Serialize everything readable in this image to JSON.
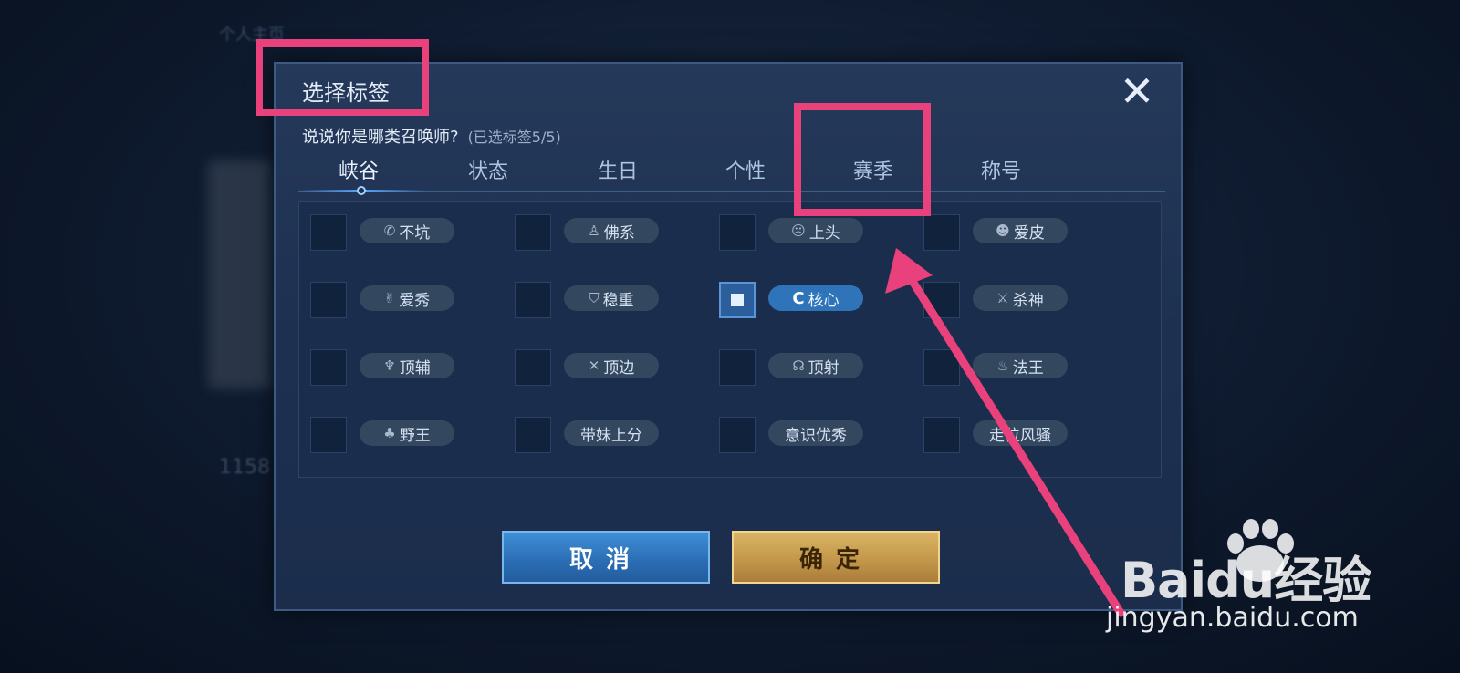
{
  "background": {
    "blurred_labels": [
      "个人主页",
      "1158"
    ]
  },
  "dialog": {
    "title": "选择标签",
    "close_icon": "close-icon",
    "subtitle": "说说你是哪类召唤师?",
    "selected_count": "(已选标签5/5)",
    "tabs": [
      {
        "label": "峡谷",
        "active": true
      },
      {
        "label": "状态",
        "active": false
      },
      {
        "label": "生日",
        "active": false
      },
      {
        "label": "个性",
        "active": false
      },
      {
        "label": "赛季",
        "active": false
      },
      {
        "label": "称号",
        "active": false
      }
    ],
    "tag_rows": [
      [
        {
          "label": "不坑",
          "icon": "phone-icon",
          "checked": false
        },
        {
          "label": "佛系",
          "icon": "buddha-icon",
          "checked": false
        },
        {
          "label": "上头",
          "icon": "face-icon",
          "checked": false
        },
        {
          "label": "爱皮",
          "icon": "cat-icon",
          "checked": false
        }
      ],
      [
        {
          "label": "爱秀",
          "icon": "peace-hand-icon",
          "checked": false
        },
        {
          "label": "稳重",
          "icon": "shield-icon",
          "checked": false
        },
        {
          "label": "核心",
          "icon": "c-letter-icon",
          "checked": true
        },
        {
          "label": "杀神",
          "icon": "sword-icon",
          "checked": false
        }
      ],
      [
        {
          "label": "顶辅",
          "icon": "wings-icon",
          "checked": false
        },
        {
          "label": "顶边",
          "icon": "crossed-swords-icon",
          "checked": false
        },
        {
          "label": "顶射",
          "icon": "bow-icon",
          "checked": false
        },
        {
          "label": "法王",
          "icon": "flame-icon",
          "checked": false
        }
      ],
      [
        {
          "label": "野王",
          "icon": "claw-icon",
          "checked": false
        },
        {
          "label": "带妹上分",
          "icon": "",
          "checked": false
        },
        {
          "label": "意识优秀",
          "icon": "",
          "checked": false
        },
        {
          "label": "走位风骚",
          "icon": "",
          "checked": false
        }
      ]
    ],
    "cancel_label": "取消",
    "confirm_label": "确定"
  },
  "watermark": {
    "logo_text": "Baidu经验",
    "url": "jingyan.baidu.com"
  },
  "colors": {
    "highlight": "#e8417c",
    "selected_tag": "#2f74b8",
    "confirm_gold": "#c2954a",
    "cancel_blue": "#2a6cb4"
  }
}
